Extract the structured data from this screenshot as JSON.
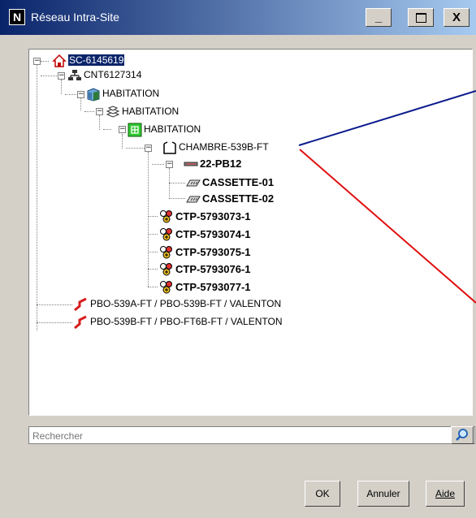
{
  "window": {
    "title": "Réseau Intra-Site",
    "app_icon_letter": "N",
    "controls": {
      "minimize": "_",
      "maximize": "☐",
      "close": "X"
    }
  },
  "tree": {
    "root": {
      "label": "SC-6145619",
      "expander": "⊟"
    },
    "container": {
      "label": "CNT6127314",
      "expander": "⊟"
    },
    "habitation_1": {
      "label": "HABITATION",
      "expander": "⊟"
    },
    "habitation_2": {
      "label": "HABITATION",
      "expander": "⊟"
    },
    "habitation_3": {
      "label": "HABITATION",
      "expander": "⊟"
    },
    "chambre": {
      "label": "CHAMBRE-539B-FT",
      "expander": "⊟"
    },
    "pb": {
      "label": "22-PB12",
      "expander": "⊟"
    },
    "cassettes": [
      "CASSETTE-01",
      "CASSETTE-02"
    ],
    "ctps": [
      "CTP-5793073-1",
      "CTP-5793074-1",
      "CTP-5793075-1",
      "CTP-5793076-1",
      "CTP-5793077-1"
    ],
    "cables": [
      "PBO-539A-FT  / PBO-539B-FT / VALENTON",
      "PBO-539B-FT / PBO-FT6B-FT / VALENTON"
    ]
  },
  "search": {
    "placeholder": "Rechercher"
  },
  "buttons": {
    "ok": "OK",
    "cancel": "Annuler",
    "help": "Aide"
  },
  "colors": {
    "titlebar_start": "#0a246a",
    "titlebar_end": "#a6caf0",
    "selection": "#0a246a",
    "annotation_blue": "#0a1a8c",
    "annotation_red": "#e01010",
    "cable_icon": "#d81b1b"
  }
}
